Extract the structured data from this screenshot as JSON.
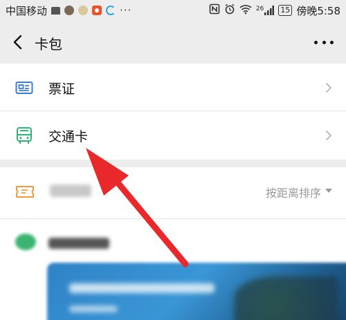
{
  "status_bar": {
    "carrier": "中国移动",
    "more": "···",
    "network": "26",
    "battery": "15",
    "time": "傍晚5:58"
  },
  "header": {
    "title": "卡包"
  },
  "list": {
    "items": [
      {
        "label": "票证",
        "icon": "ticket-card-icon"
      },
      {
        "label": "交通卡",
        "icon": "bus-icon"
      }
    ]
  },
  "cards": {
    "sort_label": "按距离排序",
    "coupon_icon": "coupon-icon"
  },
  "annotation": {
    "arrow_color": "#e8282b"
  },
  "colors": {
    "background": "#ededed",
    "icon_blue": "#3a7bd5",
    "icon_green": "#2bb673",
    "icon_orange": "#f29b38",
    "arrow_red": "#e8282b"
  }
}
